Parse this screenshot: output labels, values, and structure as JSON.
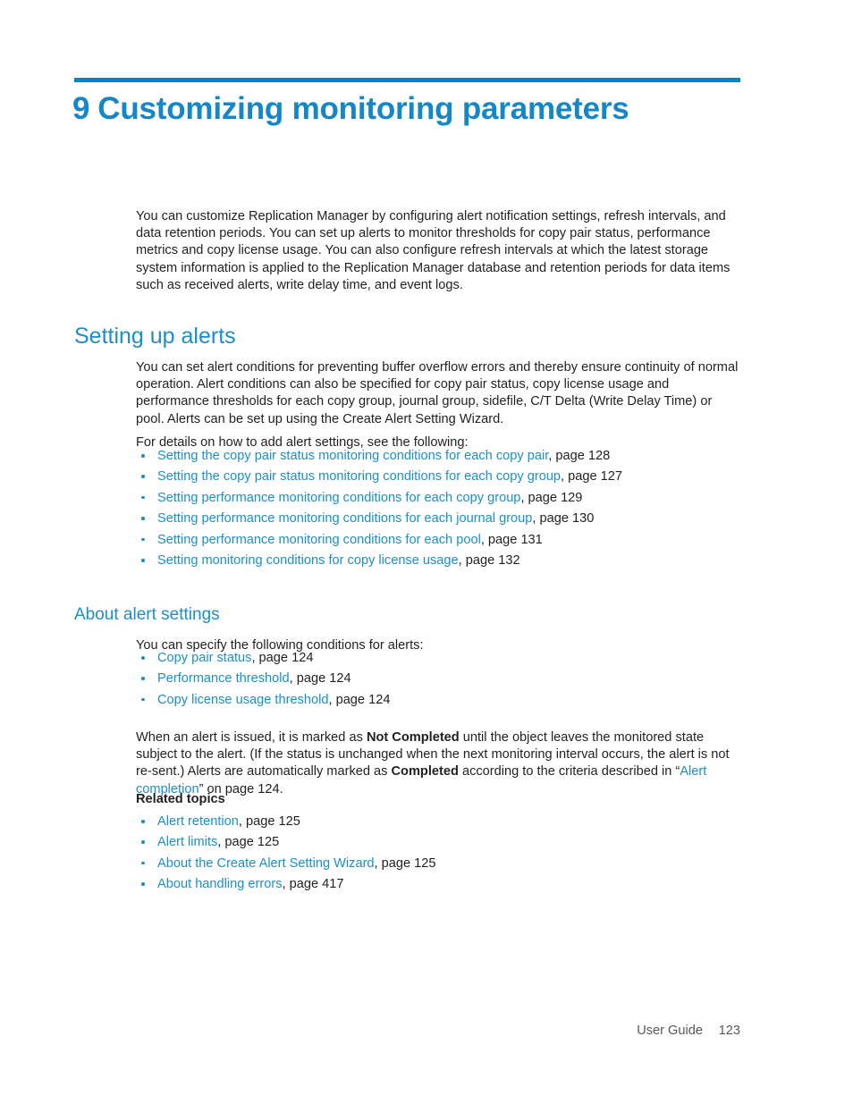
{
  "colors": {
    "accent_rule": "#0683c2",
    "chapter_title": "#1387c8",
    "heading": "#1b8fc9",
    "link": "#1b8fc9",
    "body_text": "#231f20",
    "footer_text": "#58585b",
    "page_background": "#ffffff"
  },
  "chapter": {
    "number": "9",
    "title": "Customizing monitoring parameters"
  },
  "intro": {
    "paragraph": "You can customize Replication Manager by configuring alert notification settings, refresh intervals, and data retention periods. You can set up alerts to monitor thresholds for copy pair status, performance metrics and copy license usage. You can also configure refresh intervals at which the latest storage system information is applied to the Replication Manager database and retention periods for data items such as received alerts, write delay time, and event logs."
  },
  "setting_up_alerts": {
    "heading": "Setting up alerts",
    "paragraph_1": "You can set alert conditions for preventing buffer overflow errors and thereby ensure continuity of normal operation. Alert conditions can also be specified for copy pair status, copy license usage and performance thresholds for each copy group, journal group, sidefile, C/T Delta (Write Delay Time) or pool. Alerts can be set up using the Create Alert Setting Wizard.",
    "paragraph_2": "For details on how to add alert settings, see the following:",
    "links": [
      {
        "text": "Setting the copy pair status monitoring conditions for each copy pair",
        "page": ", page 128"
      },
      {
        "text": "Setting the copy pair status monitoring conditions for each copy group",
        "page": ", page 127"
      },
      {
        "text": "Setting performance monitoring conditions for each copy group",
        "page": ", page 129"
      },
      {
        "text": "Setting performance monitoring conditions for each journal group",
        "page": ", page 130"
      },
      {
        "text": "Setting performance monitoring conditions for each pool",
        "page": ", page 131"
      },
      {
        "text": "Setting monitoring conditions for copy license usage",
        "page": ", page 132"
      }
    ]
  },
  "about_alert_settings": {
    "heading": "About alert settings",
    "paragraph_1": "You can specify the following conditions for alerts:",
    "links": [
      {
        "text": "Copy pair status",
        "page": ", page 124"
      },
      {
        "text": "Performance threshold",
        "page": ", page 124"
      },
      {
        "text": "Copy license usage threshold",
        "page": ", page 124"
      }
    ],
    "completion_paragraph": {
      "part_1": "When an alert is issued, it is marked as ",
      "bold_1": "Not Completed",
      "part_2": " until the object leaves the monitored state subject to the alert. (If the status is unchanged when the next monitoring interval occurs, the alert is not re-sent.) Alerts are automatically marked as ",
      "bold_2": "Completed",
      "part_3": " according to the criteria described in “",
      "link_text": "Alert completion",
      "part_4": "” on page 124."
    },
    "related_topics_heading": "Related topics",
    "related_topics": [
      {
        "text": "Alert retention",
        "page": ", page 125"
      },
      {
        "text": "Alert limits",
        "page": ", page 125"
      },
      {
        "text": "About the Create Alert Setting Wizard",
        "page": ", page 125"
      },
      {
        "text": "About handling errors",
        "page": ", page 417"
      }
    ]
  },
  "footer": {
    "label": "User Guide",
    "page_number": "123"
  }
}
